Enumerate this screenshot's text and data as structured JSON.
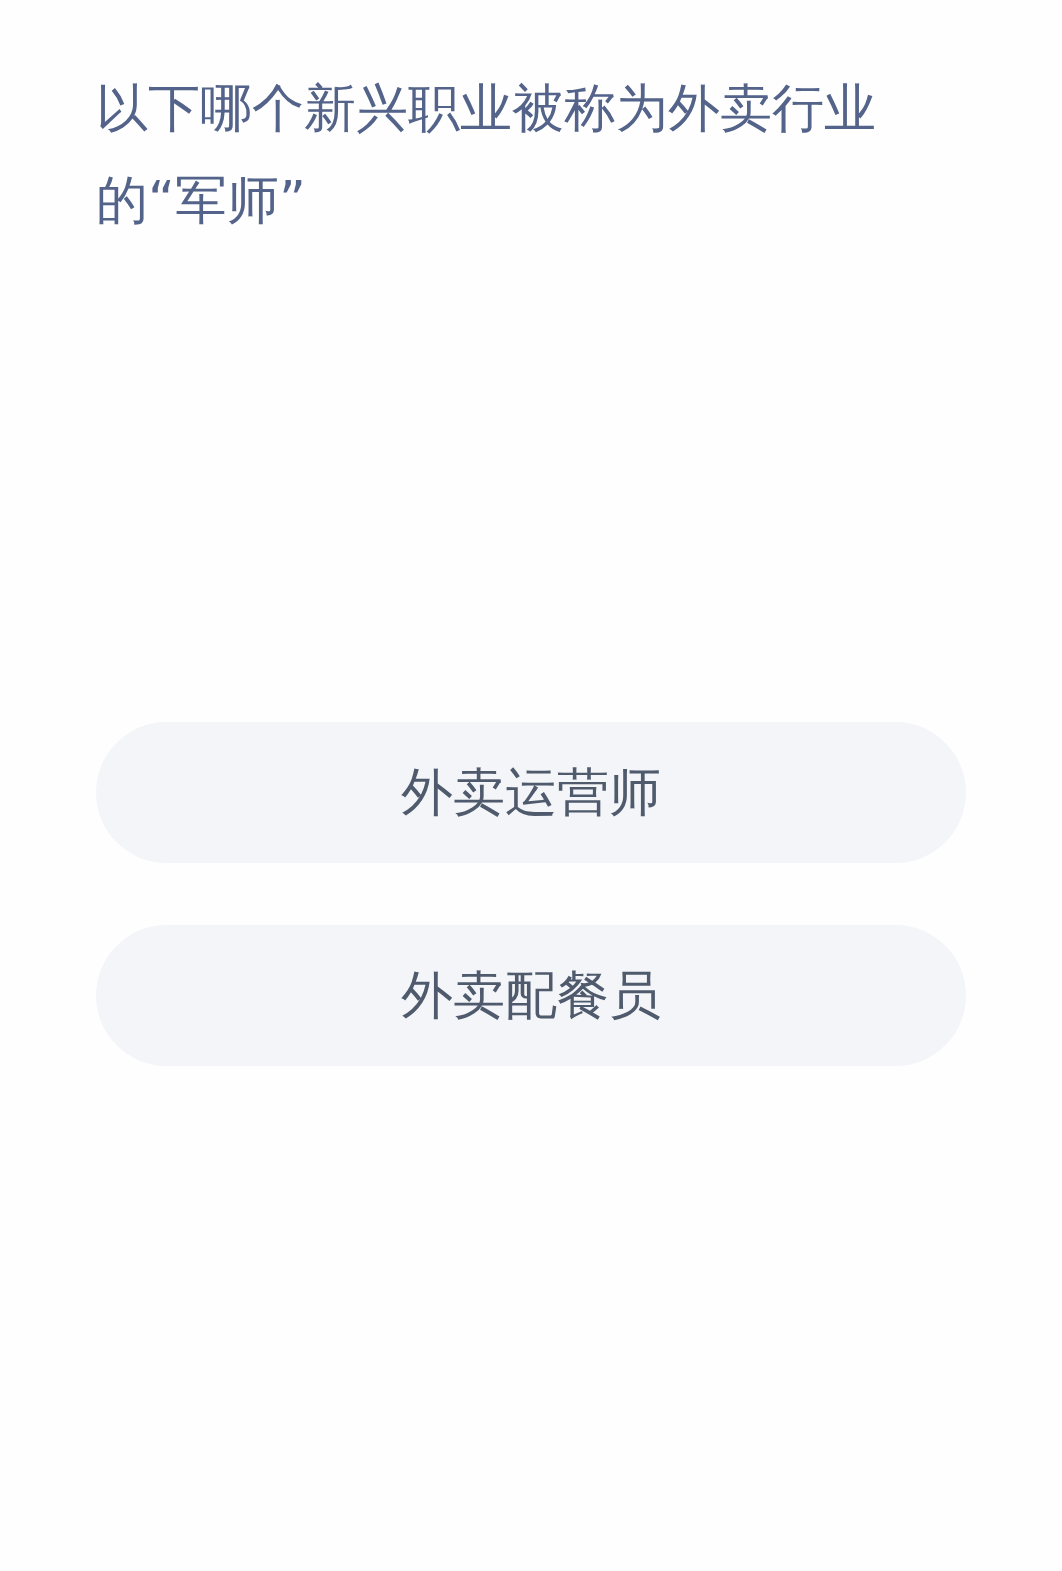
{
  "question": "以下哪个新兴职业被称为外卖行业的“军师”",
  "options": [
    "外卖运营师",
    "外卖配餐员"
  ]
}
